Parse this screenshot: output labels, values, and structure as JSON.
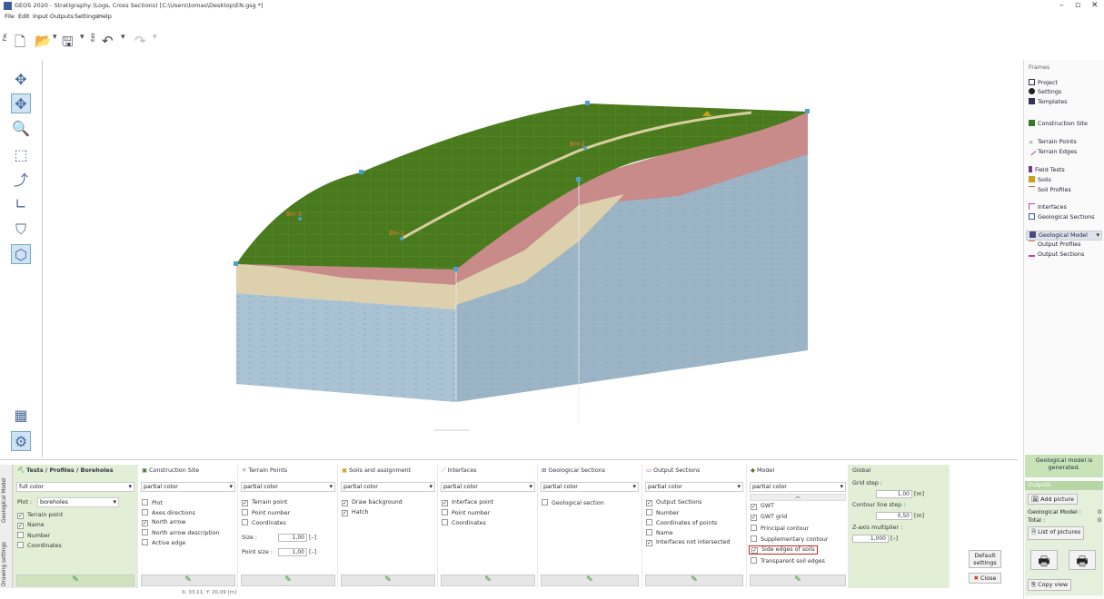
{
  "window": {
    "title": "GEOS 2020 - Stratigraphy (Logs, Cross Sections) [C:\\Users\\tomas\\Desktop\\EN.gsg *]",
    "minimize": "–",
    "maximize": "▫",
    "close": "✕"
  },
  "menu": [
    "File",
    "Edit",
    "Input",
    "Outputs",
    "Settings",
    "Help"
  ],
  "toolbar_labels": {
    "file": "File",
    "edit": "Edit"
  },
  "canvas": {
    "points": [
      "BH-3",
      "BH-2",
      "BH-1"
    ],
    "colors": {
      "terrain": "#4a7a1e",
      "grid": "#6a9a3a",
      "clay": "#c98a8a",
      "sand": "#ddd0ac",
      "rock": "#a9c2d4",
      "rock_dark": "#9bb4c6",
      "marker": "#4aa0d0"
    }
  },
  "frames": {
    "header": "Frames",
    "items": [
      {
        "label": "Project",
        "icon": "project-icon",
        "color": "#334"
      },
      {
        "label": "Settings",
        "icon": "gear-icon",
        "color": "#222"
      },
      {
        "label": "Templates",
        "icon": "templates-icon",
        "color": "#335"
      },
      {
        "label": "Construction Site",
        "icon": "construction-site-icon",
        "color": "#3a7a2a"
      },
      {
        "label": "Terrain Points",
        "icon": "terrain-points-icon",
        "color": "#888"
      },
      {
        "label": "Terrain Edges",
        "icon": "terrain-edges-icon",
        "color": "#c040a0"
      },
      {
        "label": "Field Tests",
        "icon": "field-tests-icon",
        "color": "#7a3a8a"
      },
      {
        "label": "Soils",
        "icon": "soils-icon",
        "color": "#c9a020"
      },
      {
        "label": "Soil Profiles",
        "icon": "soil-profiles-icon",
        "color": "#d07050"
      },
      {
        "label": "Interfaces",
        "icon": "interfaces-icon",
        "color": "#c040a0"
      },
      {
        "label": "Geological Sections",
        "icon": "geological-sections-icon",
        "color": "#4060a0"
      },
      {
        "label": "Geological Model",
        "icon": "geological-model-icon",
        "color": "#4a4a7a"
      },
      {
        "label": "Output Profiles",
        "icon": "output-profiles-icon",
        "color": "#d07050"
      },
      {
        "label": "Output Sections",
        "icon": "output-sections-icon",
        "color": "#c040a0"
      }
    ]
  },
  "status_message": "Geological model is generated.",
  "outputs": {
    "header": "Outputs",
    "add_picture": "Add picture",
    "geo_model_label": "Geological Model :",
    "geo_model_value": "0",
    "total_label": "Total :",
    "total_value": "0",
    "list_of_pictures": "List of pictures",
    "copy_view": "Copy view",
    "default_settings": "Default settings",
    "close": "Close"
  },
  "side_tabs": [
    "Drawing settings",
    "Geological Model"
  ],
  "panels": {
    "tests": {
      "title": "Tests / Profiles / Boreholes",
      "select": "full color",
      "plot_label": "Plot :",
      "plot_value": "boreholes",
      "checks": [
        {
          "label": "Terrain point",
          "checked": true
        },
        {
          "label": "Name",
          "checked": true
        },
        {
          "label": "Number",
          "checked": false
        },
        {
          "label": "Coordinates",
          "checked": false
        }
      ]
    },
    "construction": {
      "title": "Construction Site",
      "select": "partial color",
      "checks": [
        {
          "label": "Plot",
          "checked": false
        },
        {
          "label": "Axes directions",
          "checked": false
        },
        {
          "label": "North arrow",
          "checked": true
        },
        {
          "label": "North arrow description",
          "checked": false
        },
        {
          "label": "Active edge",
          "checked": false
        }
      ]
    },
    "terrain": {
      "title": "Terrain Points",
      "select": "partial color",
      "checks": [
        {
          "label": "Terrain point",
          "checked": true
        },
        {
          "label": "Point number",
          "checked": false
        },
        {
          "label": "Coordinates",
          "checked": false
        }
      ],
      "size_label": "Size :",
      "size_value": "1,00",
      "size_unit": "[–]",
      "point_size_label": "Point size :",
      "point_size_value": "1,00",
      "point_size_unit": "[–]"
    },
    "soils": {
      "title": "Soils and assignment",
      "select": "partial color",
      "checks": [
        {
          "label": "Draw background",
          "checked": true
        },
        {
          "label": "Hatch",
          "checked": true
        }
      ]
    },
    "interfaces": {
      "title": "Interfaces",
      "select": "partial color",
      "checks": [
        {
          "label": "Interface point",
          "checked": true
        },
        {
          "label": "Point number",
          "checked": false
        },
        {
          "label": "Coordinates",
          "checked": false
        }
      ]
    },
    "geosections": {
      "title": "Geological Sections",
      "select": "partial color",
      "checks": [
        {
          "label": "Geological section",
          "checked": false
        }
      ]
    },
    "outsections": {
      "title": "Output Sections",
      "select": "partial color",
      "checks": [
        {
          "label": "Output Sections",
          "checked": true
        },
        {
          "label": "Number",
          "checked": false
        },
        {
          "label": "Coordinates of points",
          "checked": false
        },
        {
          "label": "Name",
          "checked": false
        },
        {
          "label": "Interfaces not intersected",
          "checked": true
        }
      ]
    },
    "model": {
      "title": "Model",
      "select": "partial color",
      "checks": [
        {
          "label": "GWT",
          "checked": true
        },
        {
          "label": "GWT grid",
          "checked": true
        },
        {
          "label": "Principal contour",
          "checked": false
        },
        {
          "label": "Supplementary contour",
          "checked": false
        },
        {
          "label": "Side edges of soils",
          "checked": true
        },
        {
          "label": "Transparent soil edges",
          "checked": false
        }
      ]
    },
    "global": {
      "title": "Global",
      "grid_step_label": "Grid step :",
      "grid_step_value": "1,00",
      "grid_step_unit": "[m]",
      "contour_label": "Contour line step :",
      "contour_value": "0,50",
      "contour_unit": "[m]",
      "zaxis_label": "Z-axis multiplier :",
      "zaxis_value": "1,000",
      "zaxis_unit": "[–]"
    }
  },
  "statusbar": "X: 33,11; Y: 20,09 [m]"
}
